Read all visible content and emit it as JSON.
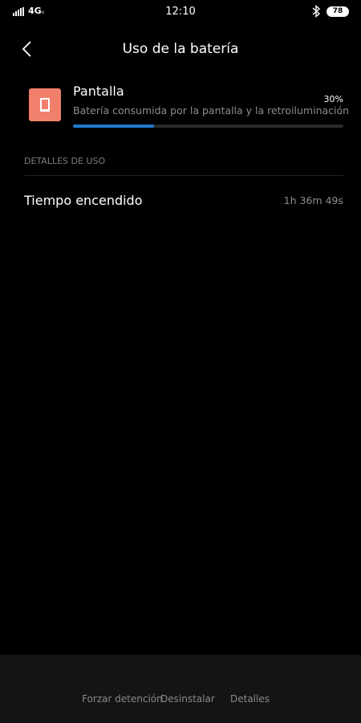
{
  "status_bar": {
    "network": "4G",
    "network_sub": "ıı",
    "time": "12:10",
    "battery": "78"
  },
  "header": {
    "title": "Uso de la batería"
  },
  "app": {
    "name": "Pantalla",
    "description": "Batería consumida por la pantalla y la retroiluminación",
    "percent_label": "30%",
    "usage_fraction": 0.3,
    "icon": "screen-icon",
    "icon_color": "#f0806c",
    "progress_color": "#1f7ad0"
  },
  "details": {
    "section_label": "DETALLES DE USO",
    "rows": [
      {
        "label": "Tiempo encendido",
        "value": "1h 36m 49s"
      }
    ]
  },
  "actions": {
    "force_stop": "Forzar detención",
    "uninstall": "Desinstalar",
    "details": "Detalles"
  }
}
